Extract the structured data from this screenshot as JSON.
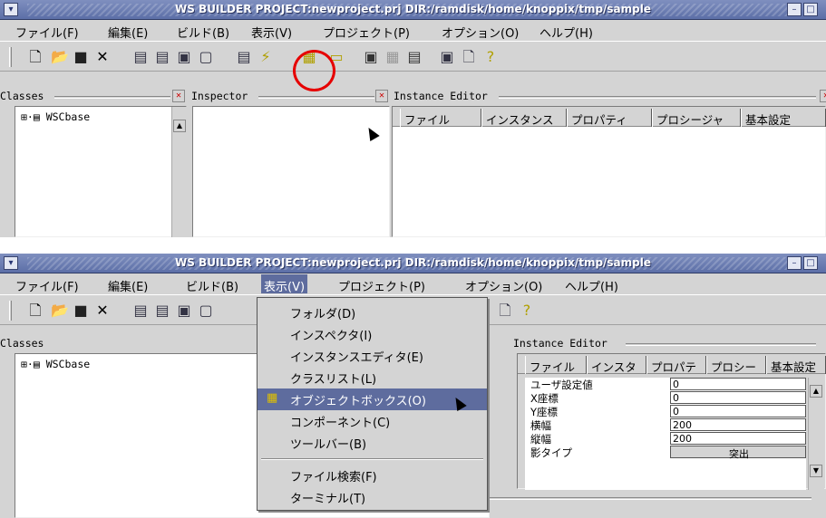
{
  "window": {
    "title": "WS BUILDER PROJECT:newproject.prj DIR:/ramdisk/home/knoppix/tmp/sample"
  },
  "menu": [
    "ファイル(F)",
    "編集(E)",
    "ビルド(B)",
    "表示(V)",
    "プロジェクト(P)",
    "オプション(O)",
    "ヘルプ(H)"
  ],
  "panes": {
    "classes": "Classes",
    "inspector": "Inspector",
    "instance_editor": "Instance Editor"
  },
  "tree": {
    "root": "WSCbase"
  },
  "tabs": [
    "ファイル",
    "インスタンス",
    "プロパティ",
    "プロシージャ",
    "基本設定"
  ],
  "tabs_short": [
    "ファイル",
    "インスタ",
    "プロパテ",
    "プロシー",
    "基本設定"
  ],
  "view_menu": [
    {
      "label": "フォルダ(D)",
      "selected": false
    },
    {
      "label": "インスペクタ(I)",
      "selected": false
    },
    {
      "label": "インスタンスエディタ(E)",
      "selected": false
    },
    {
      "label": "クラスリスト(L)",
      "selected": false
    },
    {
      "label": "オブジェクトボックス(O)",
      "selected": true
    },
    {
      "label": "コンポーネント(C)",
      "selected": false
    },
    {
      "label": "ツールバー(B)",
      "selected": false
    },
    {
      "label": "ファイル検索(F)",
      "selected": false
    },
    {
      "label": "ターミナル(T)",
      "selected": false
    }
  ],
  "properties": [
    {
      "label": "ユーザ設定値",
      "value": "0"
    },
    {
      "label": "X座標",
      "value": "0"
    },
    {
      "label": "Y座標",
      "value": "0"
    },
    {
      "label": "横幅",
      "value": "200"
    },
    {
      "label": "縦幅",
      "value": "200"
    },
    {
      "label": "影タイプ",
      "value": "突出"
    }
  ],
  "accent_color": "#5e6c9e",
  "highlight_color": "#e60000"
}
